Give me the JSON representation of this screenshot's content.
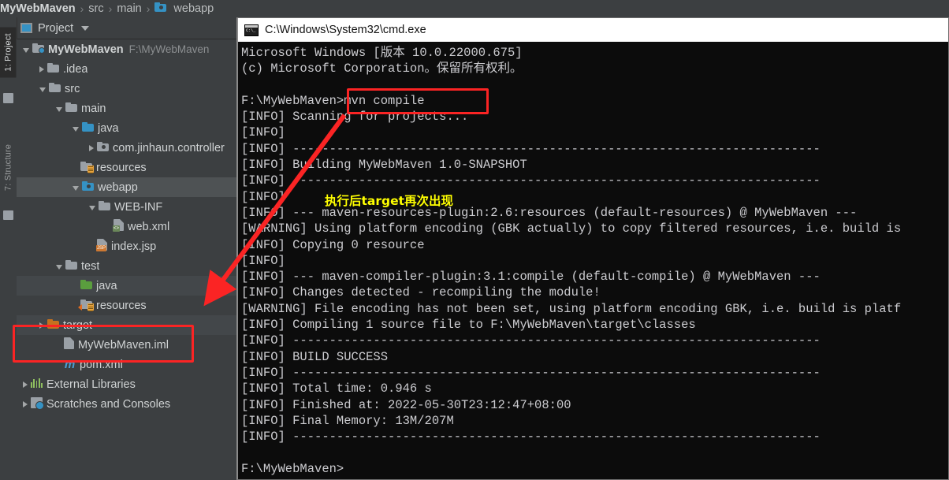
{
  "breadcrumb": {
    "items": [
      {
        "label": "MyWebMaven",
        "icon": "none",
        "bold": true
      },
      {
        "label": "src",
        "icon": "none",
        "bold": false
      },
      {
        "label": "main",
        "icon": "none",
        "bold": false
      },
      {
        "label": "webapp",
        "icon": "folder-web-icon",
        "bold": false
      }
    ],
    "separator": "›"
  },
  "tool_window": {
    "title": "Project",
    "dropdown_icon": "chevron-down-icon",
    "window_icon": "project-view-icon"
  },
  "left_strip": {
    "tabs": [
      {
        "label": "1: Project",
        "active": true
      },
      {
        "label": "7: Structure",
        "active": false
      }
    ]
  },
  "tree": {
    "items": [
      {
        "label": "MyWebMaven",
        "hint": "F:\\MyWebMaven",
        "indent": 0,
        "arrow": "open",
        "icon": "module-folder-icon",
        "bold": true,
        "state": ""
      },
      {
        "label": ".idea",
        "hint": "",
        "indent": 1,
        "arrow": "closed",
        "icon": "folder-icon",
        "bold": false,
        "state": ""
      },
      {
        "label": "src",
        "hint": "",
        "indent": 1,
        "arrow": "open",
        "icon": "folder-icon",
        "bold": false,
        "state": ""
      },
      {
        "label": "main",
        "hint": "",
        "indent": 2,
        "arrow": "open",
        "icon": "folder-icon",
        "bold": false,
        "state": ""
      },
      {
        "label": "java",
        "hint": "",
        "indent": 3,
        "arrow": "open",
        "icon": "source-folder-icon",
        "bold": false,
        "state": ""
      },
      {
        "label": "com.jinhaun.controller",
        "hint": "",
        "indent": 4,
        "arrow": "closed",
        "icon": "package-icon",
        "bold": false,
        "state": ""
      },
      {
        "label": "resources",
        "hint": "",
        "indent": 3,
        "arrow": "none",
        "icon": "resources-folder-icon",
        "bold": false,
        "state": ""
      },
      {
        "label": "webapp",
        "hint": "",
        "indent": 3,
        "arrow": "open",
        "icon": "web-folder-icon",
        "bold": false,
        "state": "sel"
      },
      {
        "label": "WEB-INF",
        "hint": "",
        "indent": 4,
        "arrow": "open",
        "icon": "folder-icon",
        "bold": false,
        "state": ""
      },
      {
        "label": "web.xml",
        "hint": "",
        "indent": 5,
        "arrow": "none",
        "icon": "web-xml-file-icon",
        "bold": false,
        "state": ""
      },
      {
        "label": "index.jsp",
        "hint": "",
        "indent": 4,
        "arrow": "none",
        "icon": "jsp-file-icon",
        "bold": false,
        "state": ""
      },
      {
        "label": "test",
        "hint": "",
        "indent": 2,
        "arrow": "open",
        "icon": "folder-icon",
        "bold": false,
        "state": ""
      },
      {
        "label": "java",
        "hint": "",
        "indent": 3,
        "arrow": "none",
        "icon": "test-source-folder-icon",
        "bold": false,
        "state": "hl"
      },
      {
        "label": "resources",
        "hint": "",
        "indent": 3,
        "arrow": "none",
        "icon": "test-resources-folder-icon",
        "bold": false,
        "state": ""
      },
      {
        "label": "target",
        "hint": "",
        "indent": 1,
        "arrow": "closed",
        "icon": "excluded-folder-icon",
        "bold": false,
        "state": "hl"
      },
      {
        "label": "MyWebMaven.iml",
        "hint": "",
        "indent": 2,
        "arrow": "none",
        "icon": "iml-file-icon",
        "bold": false,
        "state": ""
      },
      {
        "label": "pom.xml",
        "hint": "",
        "indent": 2,
        "arrow": "none",
        "icon": "maven-pom-icon",
        "bold": false,
        "state": ""
      },
      {
        "label": "External Libraries",
        "hint": "",
        "indent": 0,
        "arrow": "closed",
        "icon": "libraries-icon",
        "bold": false,
        "state": ""
      },
      {
        "label": "Scratches and Consoles",
        "hint": "",
        "indent": 0,
        "arrow": "closed",
        "icon": "scratches-icon",
        "bold": false,
        "state": ""
      }
    ]
  },
  "terminal": {
    "title": "C:\\Windows\\System32\\cmd.exe",
    "title_icon": "cmd-icon",
    "lines": [
      "Microsoft Windows [版本 10.0.22000.675]",
      "(c) Microsoft Corporation。保留所有权利。",
      "",
      "F:\\MyWebMaven>mvn compile",
      "[INFO] Scanning for projects...",
      "[INFO]",
      "[INFO] ------------------------------------------------------------------------",
      "[INFO] Building MyWebMaven 1.0-SNAPSHOT",
      "[INFO] ------------------------------------------------------------------------",
      "[INFO]",
      "[INFO] --- maven-resources-plugin:2.6:resources (default-resources) @ MyWebMaven ---",
      "[WARNING] Using platform encoding (GBK actually) to copy filtered resources, i.e. build is",
      "[INFO] Copying 0 resource",
      "[INFO]",
      "[INFO] --- maven-compiler-plugin:3.1:compile (default-compile) @ MyWebMaven ---",
      "[INFO] Changes detected - recompiling the module!",
      "[WARNING] File encoding has not been set, using platform encoding GBK, i.e. build is platf",
      "[INFO] Compiling 1 source file to F:\\MyWebMaven\\target\\classes",
      "[INFO] ------------------------------------------------------------------------",
      "[INFO] BUILD SUCCESS",
      "[INFO] ------------------------------------------------------------------------",
      "[INFO] Total time: 0.946 s",
      "[INFO] Finished at: 2022-05-30T23:12:47+08:00",
      "[INFO] Final Memory: 13M/207M",
      "[INFO] ------------------------------------------------------------------------",
      "",
      "F:\\MyWebMaven>"
    ]
  },
  "annotations": {
    "note_text": "执行后target再次出现",
    "note_color": "#ffff00",
    "box_color": "#fb2424",
    "arrow_color": "#fb2424",
    "command_box_label": "mvn compile",
    "target_box_labels": [
      "target",
      "MyWebMaven.iml"
    ]
  },
  "colors": {
    "ide_background": "#3c3f41",
    "terminal_background": "#0c0c0c",
    "terminal_text": "#ccccd0",
    "selection": "#4e5254",
    "accent_blue": "#3592c4"
  }
}
